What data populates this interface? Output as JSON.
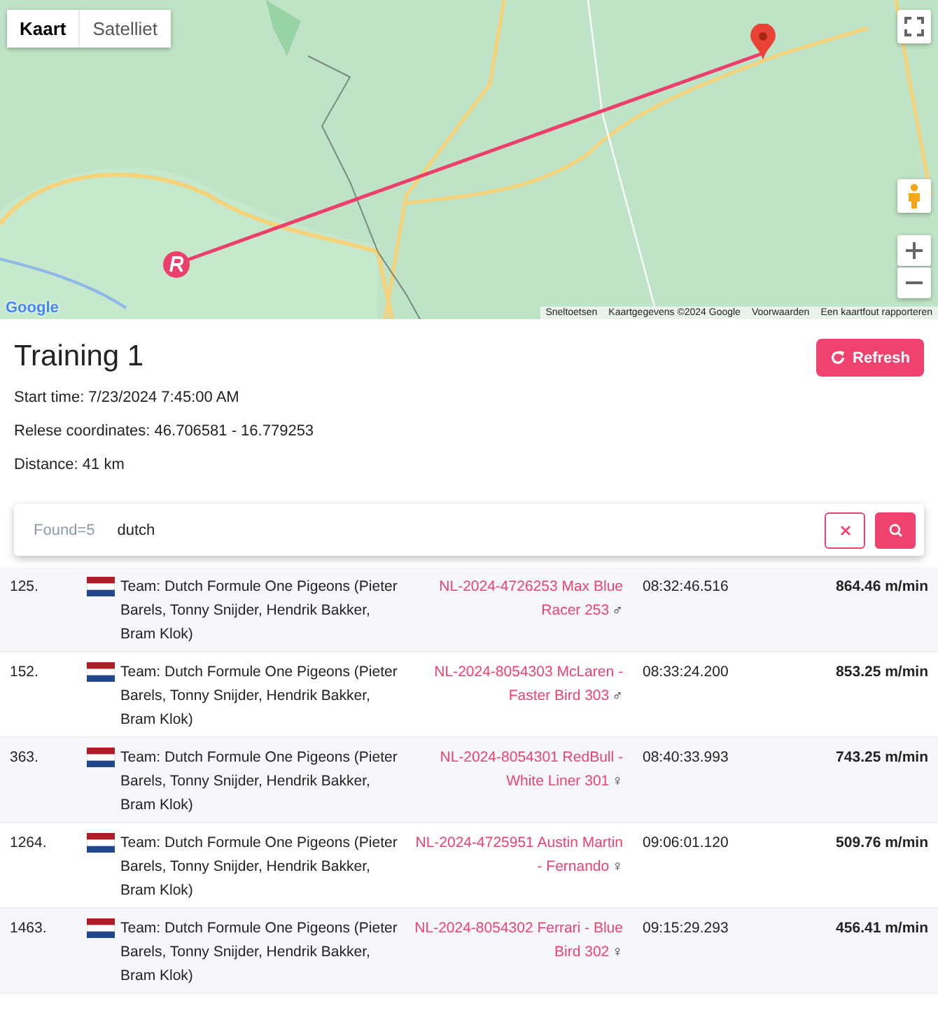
{
  "map": {
    "tabs": [
      {
        "label": "Kaart",
        "selected": true
      },
      {
        "label": "Satelliet",
        "selected": false
      }
    ],
    "logo": "Google",
    "attribution": [
      "Sneltoetsen",
      "Kaartgegevens ©2024 Google",
      "Voorwaarden",
      "Een kaartfout rapporteren"
    ]
  },
  "title": "Training 1",
  "refresh_button": "Refresh",
  "details": [
    "Start time: 7/23/2024 7:45:00 AM",
    "Relese coordinates: 46.706581 - 16.779253",
    "Distance: 41 km"
  ],
  "search": {
    "count": "Found=5",
    "value": "dutch"
  },
  "results": [
    {
      "rank": "125.",
      "team": "Team: Dutch Formule One Pigeons (Pieter Barels, Tonny Snijder, Hendrik Bakker, Bram Klok)",
      "ring": "NL-2024-4726253 Max Blue Racer 253",
      "sex": "♂",
      "time": "08:32:46.516",
      "speed": "864.46 m/min"
    },
    {
      "rank": "152.",
      "team": "Team: Dutch Formule One Pigeons (Pieter Barels, Tonny Snijder, Hendrik Bakker, Bram Klok)",
      "ring": "NL-2024-8054303 McLaren - Faster Bird 303",
      "sex": "♂",
      "time": "08:33:24.200",
      "speed": "853.25 m/min"
    },
    {
      "rank": "363.",
      "team": "Team: Dutch Formule One Pigeons (Pieter Barels, Tonny Snijder, Hendrik Bakker, Bram Klok)",
      "ring": "NL-2024-8054301 RedBull - White Liner 301",
      "sex": "♀",
      "time": "08:40:33.993",
      "speed": "743.25 m/min"
    },
    {
      "rank": "1264.",
      "team": "Team: Dutch Formule One Pigeons (Pieter Barels, Tonny Snijder, Hendrik Bakker, Bram Klok)",
      "ring": "NL-2024-4725951 Austin Martin - Fernando",
      "sex": "♀",
      "time": "09:06:01.120",
      "speed": "509.76 m/min"
    },
    {
      "rank": "1463.",
      "team": "Team: Dutch Formule One Pigeons (Pieter Barels, Tonny Snijder, Hendrik Bakker, Bram Klok)",
      "ring": "NL-2024-8054302 Ferrari - Blue Bird 302",
      "sex": "♀",
      "time": "09:15:29.293",
      "speed": "456.41 m/min"
    }
  ]
}
